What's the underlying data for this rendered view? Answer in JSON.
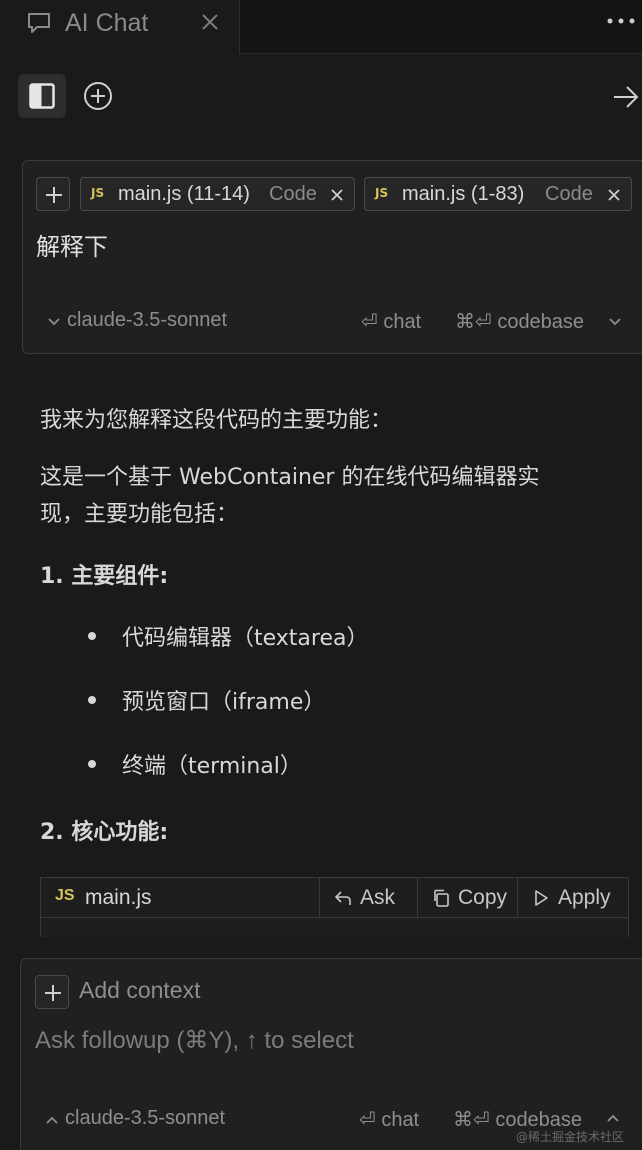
{
  "tab": {
    "title": "AI Chat"
  },
  "prompt_card": {
    "chips": [
      {
        "badge": "JS",
        "name": "main.js (11-14)",
        "kind": "Code"
      },
      {
        "badge": "JS",
        "name": "main.js (1-83)",
        "kind": "Code"
      }
    ],
    "text": "解释下",
    "model": "claude-3.5-sonnet",
    "mode_chat": "⏎ chat",
    "mode_codebase": "⌘⏎ codebase"
  },
  "response": {
    "intro": "我来为您解释这段代码的主要功能：",
    "para_line1": "这是一个基于 WebContainer 的在线代码编辑器实",
    "para_line2": "现，主要功能包括：",
    "section1": "1. 主要组件:",
    "bullets": [
      "代码编辑器（textarea）",
      "预览窗口（iframe）",
      "终端（terminal）"
    ],
    "section2": "2. 核心功能:"
  },
  "code_block": {
    "badge": "JS",
    "filename": "main.js",
    "ask_label": "Ask",
    "copy_label": "Copy",
    "apply_label": "Apply"
  },
  "input_card": {
    "add_context": "Add context",
    "placeholder": "Ask followup (⌘Y), ↑ to select",
    "model": "claude-3.5-sonnet",
    "mode_chat": "⏎ chat",
    "mode_codebase": "⌘⏎ codebase"
  },
  "watermark": "@稀土掘金技术社区"
}
